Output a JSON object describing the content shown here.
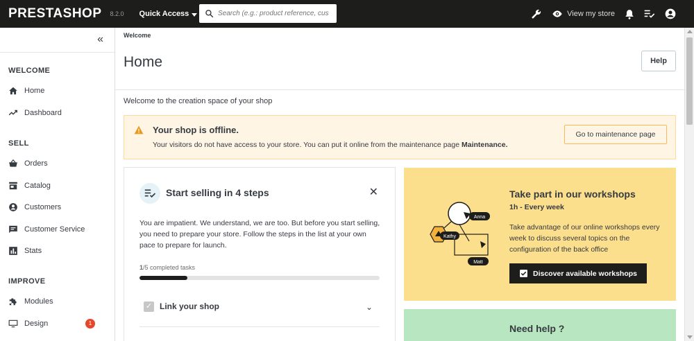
{
  "topbar": {
    "logo": "PRESTASHOP",
    "version": "8.2.0",
    "quick_access": "Quick Access",
    "search_placeholder": "Search (e.g.: product reference, custon",
    "view_store": "View my store"
  },
  "sidebar": {
    "collapse_symbol": "«",
    "sections": [
      {
        "title": "WELCOME"
      },
      {
        "title": "SELL"
      },
      {
        "title": "IMPROVE"
      }
    ],
    "items": [
      {
        "label": "Home",
        "icon": "home-icon"
      },
      {
        "label": "Dashboard",
        "icon": "trending-icon"
      },
      {
        "label": "Orders",
        "icon": "basket-icon"
      },
      {
        "label": "Catalog",
        "icon": "store-icon"
      },
      {
        "label": "Customers",
        "icon": "account-circle-icon"
      },
      {
        "label": "Customer Service",
        "icon": "chat-icon"
      },
      {
        "label": "Stats",
        "icon": "bar-chart-icon"
      },
      {
        "label": "Modules",
        "icon": "puzzle-icon"
      },
      {
        "label": "Design",
        "icon": "desktop-icon",
        "badge": "1"
      }
    ]
  },
  "header": {
    "breadcrumb": "Welcome",
    "title": "Home",
    "help": "Help"
  },
  "content": {
    "welcome": "Welcome to the creation space of your shop",
    "offline": {
      "title": "Your shop is offline.",
      "text": "Your visitors do not have access to your store. You can put it online from the maintenance page",
      "text_bold": "Maintenance.",
      "button": "Go to maintenance page"
    },
    "steps": {
      "title": "Start selling in 4 steps",
      "close": "✕",
      "description": "You are impatient. We understand, we are too. But before you start selling, you need to prepare your store. Follow the steps in the list at your own pace to prepare for launch.",
      "completed_count": "1",
      "completed_rest": "/5 completed tasks",
      "progress": 0.2,
      "task_label": "Link your shop"
    },
    "workshop": {
      "title": "Take part in our workshops",
      "subtitle": "1h - Every week",
      "description": "Take advantage of our online workshops every week to discuss several topics on the configuration of the back office",
      "button": "Discover available workshops",
      "names": [
        "Anna",
        "Kathy",
        "Matt"
      ]
    },
    "need_help": "Need help ?"
  },
  "colors": {
    "topbar": "#1d1d1b",
    "workshop_bg": "#fbdf8c",
    "offline_bg": "#fff5e5",
    "need_help_bg": "#b8e6c1",
    "badge": "#e5472c"
  }
}
